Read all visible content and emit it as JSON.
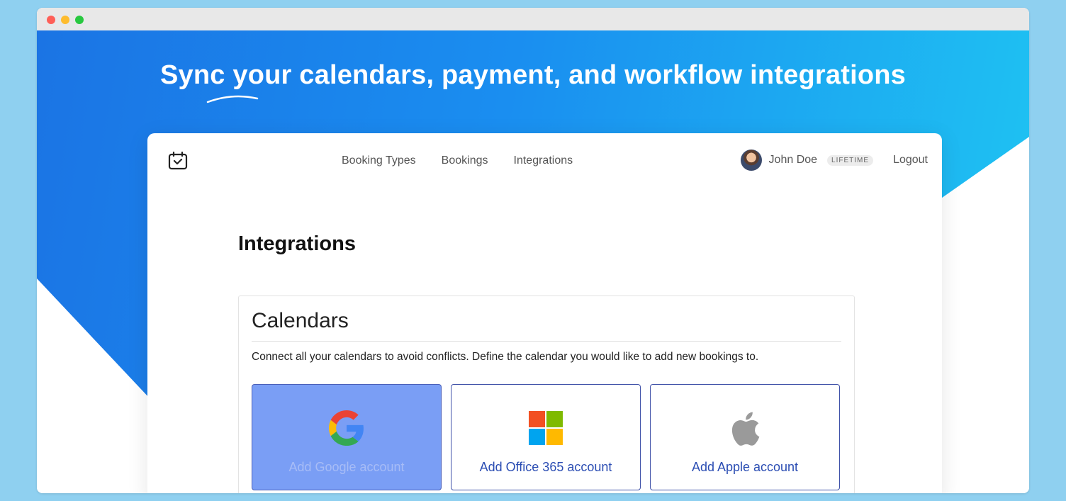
{
  "hero": {
    "headline": "Sync your calendars, payment, and workflow integrations"
  },
  "app": {
    "nav": [
      {
        "label": "Booking Types"
      },
      {
        "label": "Bookings"
      },
      {
        "label": "Integrations"
      }
    ],
    "user": {
      "name": "John Doe",
      "badge": "LIFETIME",
      "logout_label": "Logout"
    },
    "page_title": "Integrations",
    "calendars": {
      "title": "Calendars",
      "description": "Connect all your calendars to avoid conflicts. Define the calendar you would like to add new bookings to.",
      "cards": [
        {
          "label": "Add Google account",
          "icon": "google-icon",
          "state": "active"
        },
        {
          "label": "Add Office 365 account",
          "icon": "microsoft-icon",
          "state": "default"
        },
        {
          "label": "Add Apple account",
          "icon": "apple-icon",
          "state": "default"
        }
      ]
    }
  },
  "colors": {
    "gradient_start": "#1b74e4",
    "gradient_end": "#1fc6f2",
    "link_blue": "#2b4db3",
    "active_card": "#7a9ef5",
    "page_background": "#8fd0f0"
  }
}
